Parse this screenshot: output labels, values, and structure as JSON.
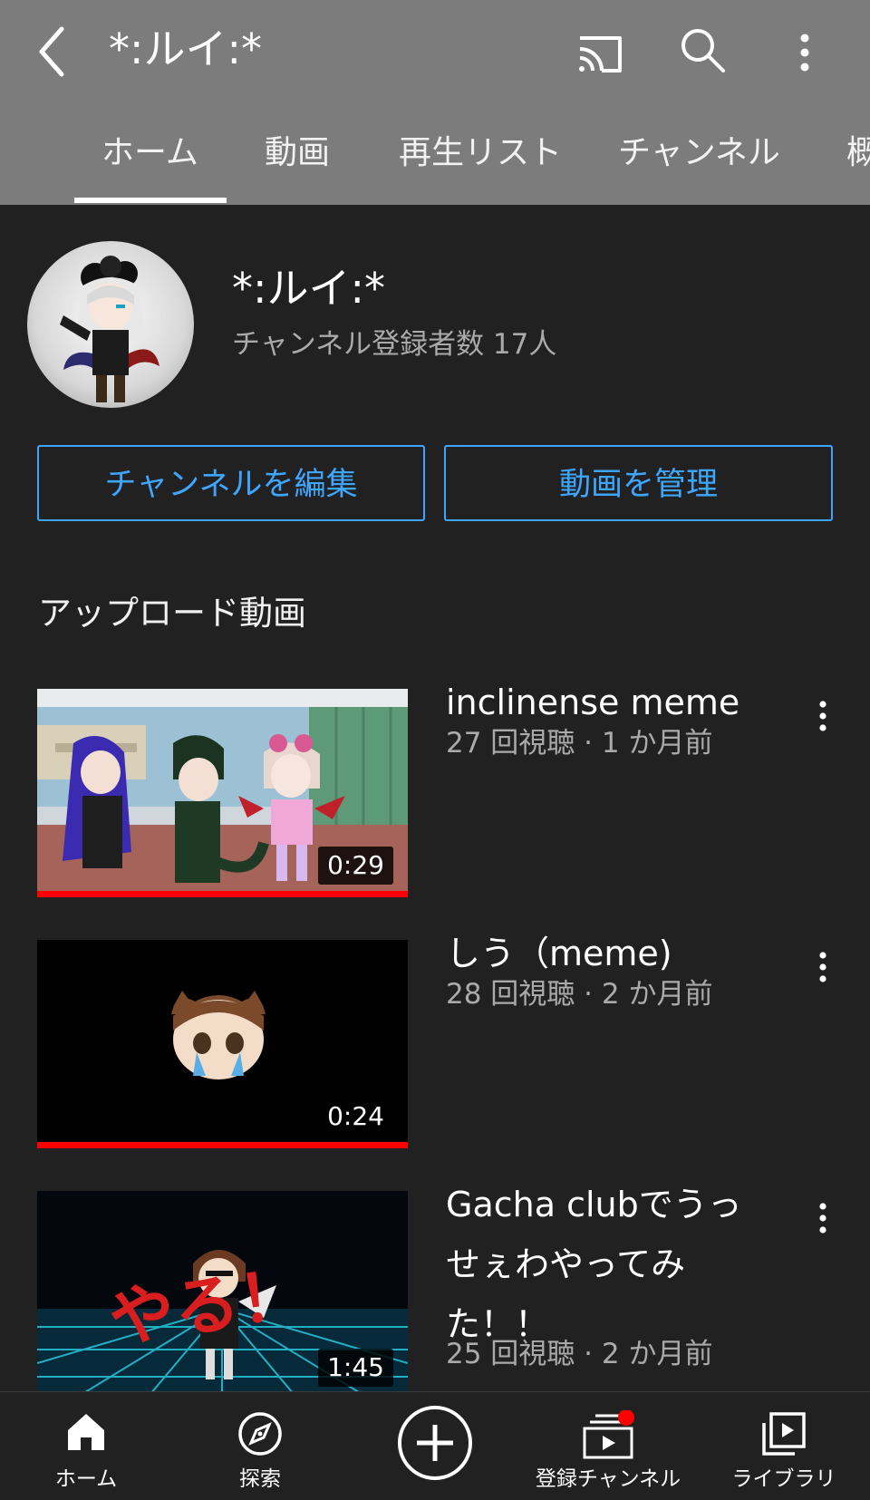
{
  "header": {
    "title": "*:ルイ:*"
  },
  "tabs": [
    {
      "label": "ホーム",
      "active": true
    },
    {
      "label": "動画"
    },
    {
      "label": "再生リスト"
    },
    {
      "label": "チャンネル"
    },
    {
      "label": "概"
    }
  ],
  "channel": {
    "name": "*:ルイ:*",
    "subscribers": "チャンネル登録者数 17人",
    "edit_label": "チャンネルを編集",
    "manage_label": "動画を管理"
  },
  "section_title": "アップロード動画",
  "videos": [
    {
      "title": "inclinense meme",
      "meta": "27 回視聴 · 1 か月前",
      "duration": "0:29",
      "progress": 1.0
    },
    {
      "title": "しう（meme)",
      "meta": "28 回視聴 · 2 か月前",
      "duration": "0:24",
      "progress": 1.0
    },
    {
      "title": "Gacha clubでうっせぇわやってみた！！",
      "meta": "25 回視聴 · 2 か月前",
      "duration": "1:45",
      "thumb_text": "やる！"
    }
  ],
  "bottom_nav": [
    {
      "label": "ホーム",
      "icon": "home-icon"
    },
    {
      "label": "探索",
      "icon": "compass-icon"
    },
    {
      "label": "",
      "icon": "create-icon"
    },
    {
      "label": "登録チャンネル",
      "icon": "subscriptions-icon"
    },
    {
      "label": "ライブラリ",
      "icon": "library-icon"
    }
  ],
  "colors": {
    "accent": "#3ea6ff",
    "progress": "#ff0000",
    "topbar": "#7c7c7c",
    "background": "#212121"
  }
}
